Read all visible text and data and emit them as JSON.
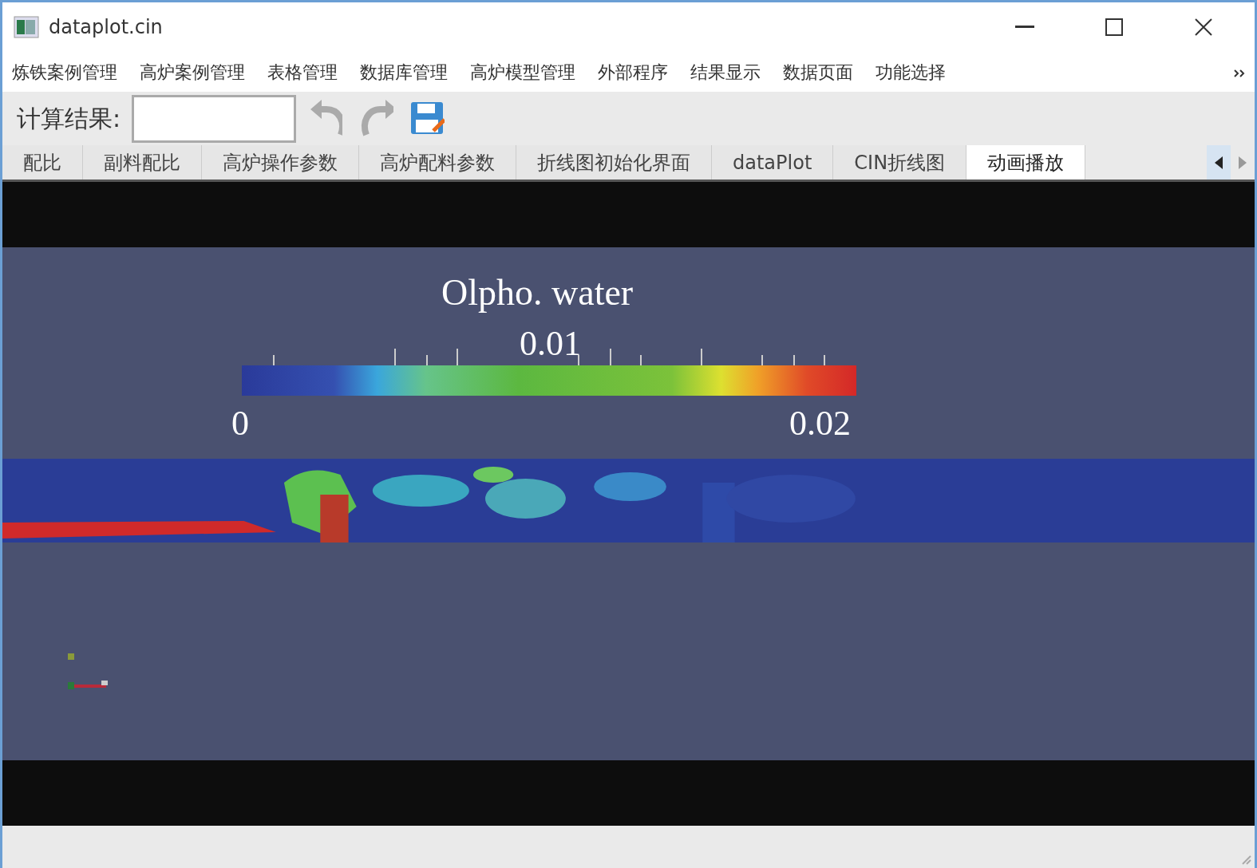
{
  "window": {
    "title": "dataplot.cin"
  },
  "menu": [
    "炼铁案例管理",
    "高炉案例管理",
    "表格管理",
    "数据库管理",
    "高炉模型管理",
    "外部程序",
    "结果显示",
    "数据页面",
    "功能选择"
  ],
  "toolbar": {
    "label": "计算结果:"
  },
  "tabs": [
    {
      "label": "配比",
      "selected": false
    },
    {
      "label": "副料配比",
      "selected": false
    },
    {
      "label": "高炉操作参数",
      "selected": false
    },
    {
      "label": "高炉配料参数",
      "selected": false
    },
    {
      "label": "折线图初始化界面",
      "selected": false
    },
    {
      "label": "dataPlot",
      "selected": false
    },
    {
      "label": "CIN折线图",
      "selected": false
    },
    {
      "label": "动画播放",
      "selected": true
    }
  ],
  "viewer": {
    "legend": {
      "title": "Olpho. water",
      "mid_label": "0.01",
      "min_label": "0",
      "max_label": "0.02"
    }
  }
}
